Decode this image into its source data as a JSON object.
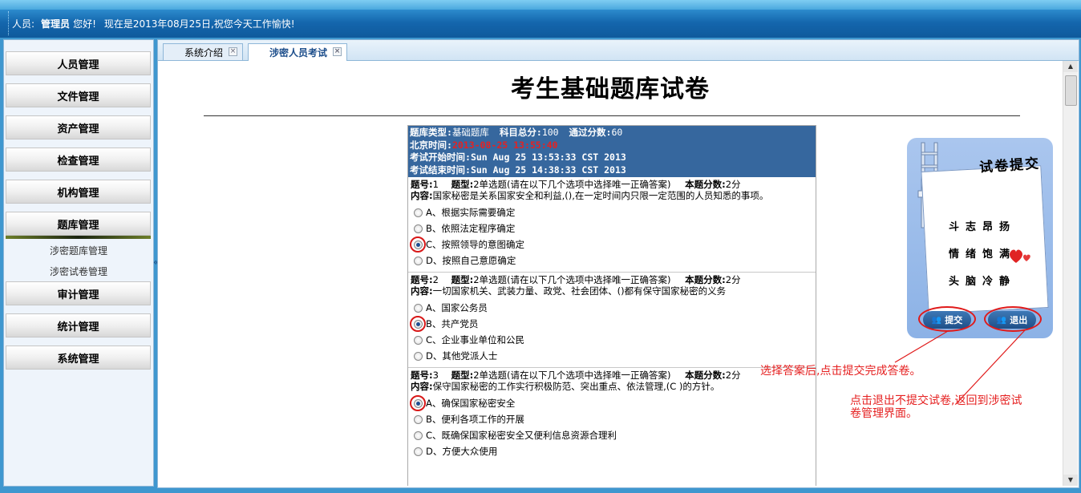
{
  "header": {
    "user_label": "人员:",
    "user_name": "管理员",
    "greeting": "您好!",
    "date_text": "现在是2013年08月25日,祝您今天工作愉快!"
  },
  "sidebar": {
    "items": [
      {
        "label": "人员管理"
      },
      {
        "label": "文件管理"
      },
      {
        "label": "资产管理"
      },
      {
        "label": "检查管理"
      },
      {
        "label": "机构管理"
      },
      {
        "label": "题库管理"
      },
      {
        "label": "审计管理"
      },
      {
        "label": "统计管理"
      },
      {
        "label": "系统管理"
      }
    ],
    "submenu": [
      {
        "label": "涉密题库管理"
      },
      {
        "label": "涉密试卷管理"
      }
    ],
    "collapse_glyph": "«"
  },
  "tabs": [
    {
      "label": "系统介绍",
      "close": "×"
    },
    {
      "label": "涉密人员考试",
      "close": "×"
    }
  ],
  "page_title": "考生基础题库试卷",
  "exam_info": {
    "bank_type_label": "题库类型:",
    "bank_type": "基础题库",
    "total_label": "科目总分:",
    "total": "100",
    "pass_label": "通过分数:",
    "pass": "60",
    "beijing_time_label": "北京时间:",
    "beijing_time": "2013-08-25 13:55:40",
    "start_label": "考试开始时间:",
    "start_time": "Sun Aug 25 13:53:33 CST 2013",
    "end_label": "考试结束时间:",
    "end_time": "Sun Aug 25 14:38:33 CST 2013"
  },
  "questions": [
    {
      "no_label": "题号:",
      "no": "1",
      "type_label": "题型:",
      "type": "2单选题(请在以下几个选项中选择唯一正确答案)",
      "score_label": "本题分数:",
      "score": "2分",
      "content_label": "内容:",
      "content": "国家秘密是关系国家安全和利益,(),在一定时间内只限一定范围的人员知悉的事项。",
      "options": [
        {
          "text": "A、根据实际需要确定",
          "checked": false
        },
        {
          "text": "B、依照法定程序确定",
          "checked": false
        },
        {
          "text": "C、按照领导的意图确定",
          "checked": true
        },
        {
          "text": "D、按照自己意愿确定",
          "checked": false
        }
      ]
    },
    {
      "no_label": "题号:",
      "no": "2",
      "type_label": "题型:",
      "type": "2单选题(请在以下几个选项中选择唯一正确答案)",
      "score_label": "本题分数:",
      "score": "2分",
      "content_label": "内容:",
      "content": "一切国家机关、武装力量、政党、社会团体、()都有保守国家秘密的义务",
      "options": [
        {
          "text": "A、国家公务员",
          "checked": false
        },
        {
          "text": "B、共产党员",
          "checked": true
        },
        {
          "text": "C、企业事业单位和公民",
          "checked": false
        },
        {
          "text": "D、其他党派人士",
          "checked": false
        }
      ]
    },
    {
      "no_label": "题号:",
      "no": "3",
      "type_label": "题型:",
      "type": "2单选题(请在以下几个选项中选择唯一正确答案)",
      "score_label": "本题分数:",
      "score": "2分",
      "content_label": "内容:",
      "content": "保守国家秘密的工作实行积极防范、突出重点、依法管理,(C )的方针。",
      "options": [
        {
          "text": "A、确保国家秘密安全",
          "checked": true
        },
        {
          "text": "B、便利各项工作的开展",
          "checked": false
        },
        {
          "text": "C、既确保国家秘密安全又便利信息资源合理利",
          "checked": false
        },
        {
          "text": "D、方便大众使用",
          "checked": false
        }
      ]
    }
  ],
  "submit_card": {
    "title": "试卷提交",
    "mottos": [
      "斗志昂扬",
      "情绪饱满",
      "头脑冷静"
    ],
    "submit_label": "提交",
    "exit_label": "退出"
  },
  "annotations": {
    "submit_note": "选择答案后,点击提交完成答卷。",
    "exit_note_line1": "点击退出不提交试卷,返回到涉密试",
    "exit_note_line2": "卷管理界面。"
  },
  "colors": {
    "header_blue": "#1466ad",
    "exam_header_bg": "#36679e",
    "highlight_red": "#e01a1a",
    "tab_active_text": "#1e4f8c"
  }
}
